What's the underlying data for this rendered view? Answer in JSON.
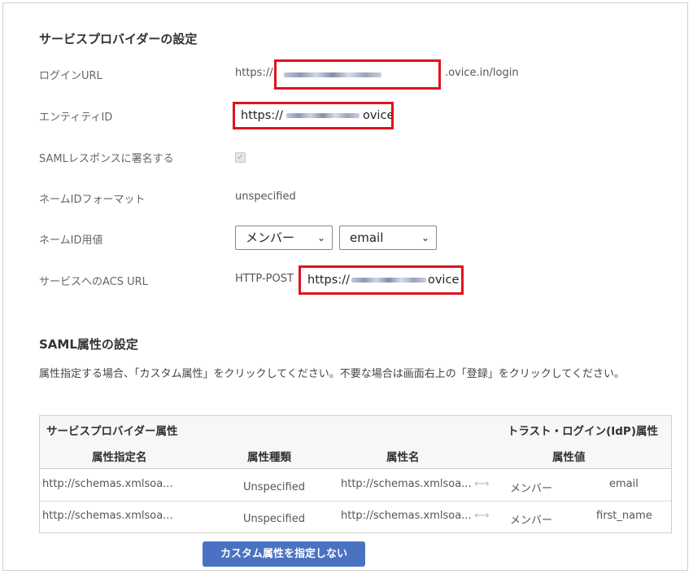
{
  "sp_section": {
    "title": "サービスプロバイダーの設定",
    "login_url": {
      "label": "ログインURL",
      "prefix": "https://",
      "suffix": ".ovice.in/login"
    },
    "entity_id": {
      "label": "エンティティID",
      "value_start": "https://",
      "value_end": "ovice"
    },
    "saml_sign": {
      "label": "SAMLレスポンスに署名する",
      "checked": true
    },
    "nameid_format": {
      "label": "ネームIDフォーマット",
      "value": "unspecified"
    },
    "nameid_value": {
      "label": "ネームID用値",
      "select1": "メンバー",
      "select2": "email"
    },
    "acs_url": {
      "label": "サービスへのACS URL",
      "binding": "HTTP-POST",
      "value_start": "https://",
      "value_end": "ovice"
    }
  },
  "attr_section": {
    "title": "SAML属性の設定",
    "description": "属性指定する場合、「カスタム属性」をクリックしてください。不要な場合は画面右上の「登録」をクリックしてください。",
    "table": {
      "sp_header": "サービスプロバイダー属性",
      "idp_header": "トラスト・ログイン(IdP)属性",
      "columns": [
        "属性指定名",
        "属性種類",
        "属性名",
        "属性値"
      ],
      "rows": [
        {
          "name": "http://schemas.xmlsoa...",
          "type": "Unspecified",
          "attr": "http://schemas.xmlsoa...",
          "source": "メンバー",
          "value": "email"
        },
        {
          "name": "http://schemas.xmlsoa...",
          "type": "Unspecified",
          "attr": "http://schemas.xmlsoa...",
          "source": "メンバー",
          "value": "first_name"
        }
      ]
    },
    "button_label": "カスタム属性を指定しない"
  },
  "colors": {
    "highlight": "#e0141d",
    "button": "#4a72c2"
  }
}
